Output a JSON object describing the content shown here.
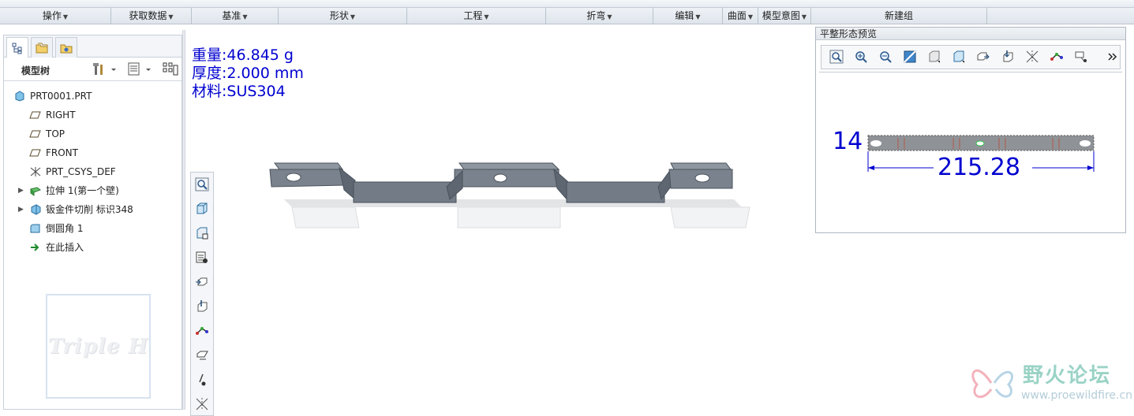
{
  "ribbon": {
    "groups": [
      {
        "label": "操作",
        "width": 141
      },
      {
        "label": "获取数据",
        "width": 102
      },
      {
        "label": "基准",
        "width": 110
      },
      {
        "label": "形状",
        "width": 163
      },
      {
        "label": "工程",
        "width": 176
      },
      {
        "label": "折弯",
        "width": 136
      },
      {
        "label": "编辑",
        "width": 88
      },
      {
        "label": "曲面",
        "width": 45
      },
      {
        "label": "模型意图",
        "width": 67
      },
      {
        "label": "新建组",
        "width": 223
      }
    ]
  },
  "model_tree": {
    "title": "模型树",
    "items": [
      {
        "label": "PRT0001.PRT",
        "icon": "part-icon",
        "indent": 0,
        "expandable": false
      },
      {
        "label": "RIGHT",
        "icon": "datum-plane-icon",
        "indent": 1,
        "expandable": false
      },
      {
        "label": "TOP",
        "icon": "datum-plane-icon",
        "indent": 1,
        "expandable": false
      },
      {
        "label": "FRONT",
        "icon": "datum-plane-icon",
        "indent": 1,
        "expandable": false
      },
      {
        "label": "PRT_CSYS_DEF",
        "icon": "csys-icon",
        "indent": 1,
        "expandable": false
      },
      {
        "label": "拉伸 1(第一个壁)",
        "icon": "extrude-wall-icon",
        "indent": 1,
        "expandable": true
      },
      {
        "label": "钣金件切削 标识348",
        "icon": "sheetmetal-cut-icon",
        "indent": 1,
        "expandable": true
      },
      {
        "label": "倒圆角 1",
        "icon": "round-icon",
        "indent": 1,
        "expandable": false
      },
      {
        "label": "在此插入",
        "icon": "insert-here-icon",
        "indent": 1,
        "expandable": false
      }
    ],
    "watermark": "Triple H"
  },
  "model_info": {
    "mass": "重量:46.845 g",
    "thickness": "厚度:2.000 mm",
    "material": "材料:SUS304"
  },
  "view_toolbar": [
    "zoom-fit-icon",
    "shaded-view-icon",
    "saved-views-icon",
    "display-style-icon",
    "datum-plane-display-icon",
    "datum-axis-display-icon",
    "csys-display-icon",
    "plane-tag-icon",
    "axis-tag-icon",
    "point-display-icon"
  ],
  "flat_preview": {
    "title": "平整形态预览",
    "toolbar": [
      "zoom-fit-icon",
      "zoom-in-icon",
      "zoom-out-icon",
      "repaint-icon",
      "shading-icon",
      "saved-view-icon",
      "plane-display-icon",
      "axis-display-icon",
      "point-display-icon",
      "csys-display-icon",
      "annotation-display-icon",
      "more-icon"
    ],
    "dim_height": "14",
    "dim_length": "215.28",
    "colors": {
      "dimension": "#0000d0",
      "part": "#8f9397"
    }
  },
  "logo": {
    "name": "野火论坛",
    "url": "www.proewildfire.cn"
  }
}
